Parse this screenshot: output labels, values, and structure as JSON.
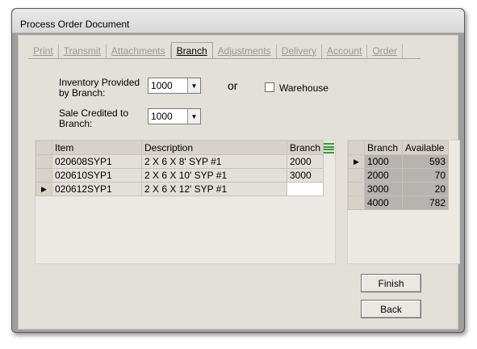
{
  "window": {
    "title": "Process Order Document"
  },
  "tabs": [
    {
      "label": "Print",
      "active": false
    },
    {
      "label": "Transmit",
      "active": false
    },
    {
      "label": "Attachments",
      "active": false
    },
    {
      "label": "Branch",
      "active": true
    },
    {
      "label": "Adjustments",
      "active": false
    },
    {
      "label": "Delivery",
      "active": false
    },
    {
      "label": "Account",
      "active": false
    },
    {
      "label": "Order",
      "active": false
    }
  ],
  "form": {
    "inventory_label_line1": "Inventory Provided",
    "inventory_label_line2": "by Branch:",
    "inventory_value": "1000",
    "or_text": "or",
    "warehouse_label": "Warehouse",
    "warehouse_checked": false,
    "sale_label_line1": "Sale Credited to",
    "sale_label_line2": "Branch:",
    "sale_value": "1000"
  },
  "items_grid": {
    "headers": {
      "item": "Item",
      "description": "Description",
      "branch": "Branch"
    },
    "rows": [
      {
        "item": "020608SYP1",
        "description": "2 X 6 X 8' SYP #1",
        "branch": "2000",
        "current": false
      },
      {
        "item": "020610SYP1",
        "description": "2 X 6 X 10' SYP #1",
        "branch": "3000",
        "current": false
      },
      {
        "item": "020612SYP1",
        "description": "2 X 6 X 12' SYP #1",
        "branch": "",
        "current": true
      }
    ]
  },
  "availability_grid": {
    "headers": {
      "branch": "Branch",
      "available": "Available"
    },
    "rows": [
      {
        "branch": "1000",
        "available": "593",
        "current": true
      },
      {
        "branch": "2000",
        "available": "70",
        "current": false
      },
      {
        "branch": "3000",
        "available": "20",
        "current": false
      },
      {
        "branch": "4000",
        "available": "782",
        "current": false
      }
    ]
  },
  "buttons": {
    "finish": "Finish",
    "back": "Back"
  },
  "icons": {
    "row_pointer": "triangle-right-icon",
    "dropdown": "chevron-down-icon",
    "grid_settings": "column-chooser-icon"
  },
  "colors": {
    "client_bg": "#e3dfd9",
    "header_bg": "#d7d2c9",
    "selected_cell": "#b6b3b0",
    "grid_icon": "#2f9a2f"
  }
}
